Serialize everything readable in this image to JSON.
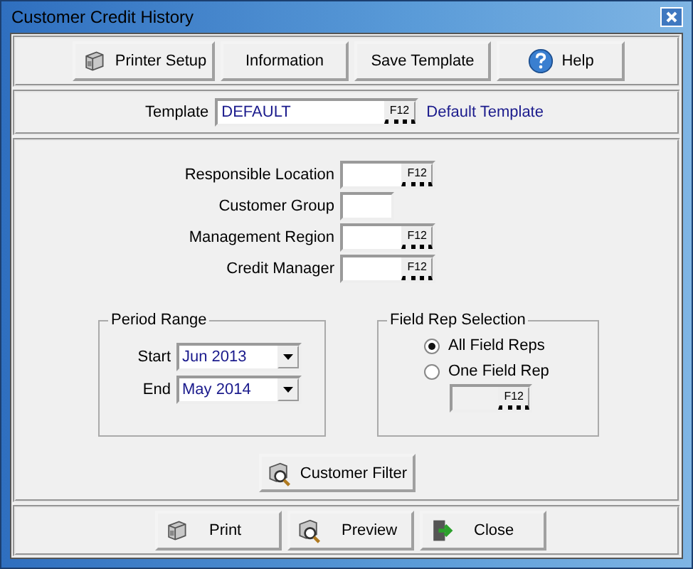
{
  "window": {
    "title": "Customer Credit History"
  },
  "toolbar": [
    {
      "label": "Printer Setup",
      "kind": "printer"
    },
    {
      "label": "Information",
      "kind": "plain"
    },
    {
      "label": "Save Template",
      "kind": "plain"
    },
    {
      "label": "Help",
      "kind": "help"
    }
  ],
  "template": {
    "label": "Template",
    "value": "DEFAULT",
    "lookup": "F12",
    "description": "Default Template"
  },
  "filters": [
    {
      "label": "Responsible Location",
      "lookup": "F12"
    },
    {
      "label": "Customer Group"
    },
    {
      "label": "Management Region",
      "lookup": "F12"
    },
    {
      "label": "Credit Manager",
      "lookup": "F12"
    }
  ],
  "period_range": {
    "title": "Period Range",
    "fields": [
      {
        "label": "Start",
        "value": "Jun 2013"
      },
      {
        "label": "End",
        "value": "May 2014"
      }
    ]
  },
  "field_rep_selection": {
    "title": "Field Rep Selection",
    "options": [
      {
        "label": "All Field Reps",
        "selected": true
      },
      {
        "label": "One Field Rep",
        "selected": false
      }
    ],
    "lookup": "F12"
  },
  "customer_filter": {
    "label": "Customer Filter",
    "kind": "preview"
  },
  "bottom_buttons": [
    {
      "label": "Print",
      "kind": "printer"
    },
    {
      "label": "Preview",
      "kind": "preview"
    },
    {
      "label": "Close",
      "kind": "exit"
    }
  ]
}
